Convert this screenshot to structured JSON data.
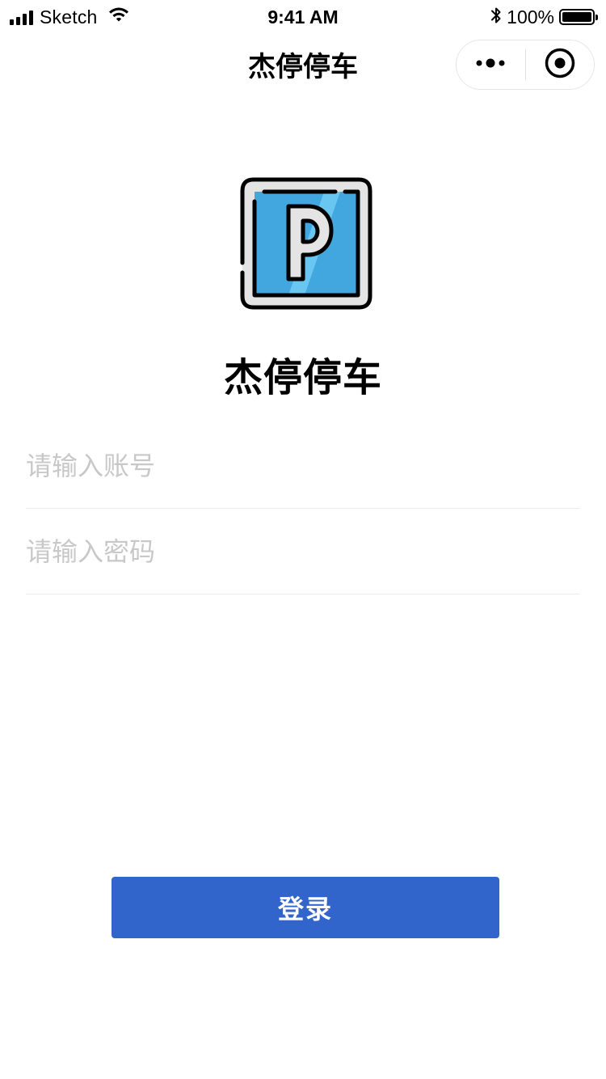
{
  "status_bar": {
    "carrier": "Sketch",
    "time": "9:41 AM",
    "battery": "100%",
    "battery_level": 1.0,
    "icons": [
      "signal-icon",
      "wifi-icon",
      "bluetooth-icon",
      "battery-icon"
    ]
  },
  "nav": {
    "title": "杰停停车",
    "capsule_icons": [
      "more-icon",
      "close-target-icon"
    ]
  },
  "main": {
    "logo_icon": "parking-sign-icon",
    "app_name": "杰停停车",
    "account_placeholder": "请输入账号",
    "password_placeholder": "请输入密码",
    "account_value": "",
    "password_value": "",
    "login_label": "登录"
  },
  "colors": {
    "primary": "#3165cc",
    "logo_blue": "#42a6df",
    "logo_light_blue": "#69c6f0",
    "placeholder": "#c8c8c8",
    "divider": "#ececec"
  }
}
